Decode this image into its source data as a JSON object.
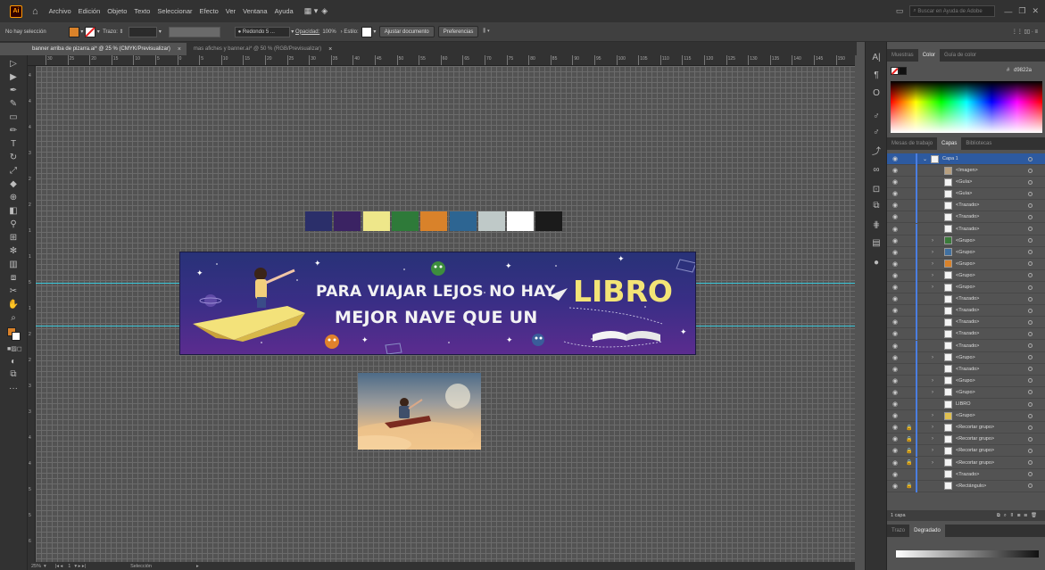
{
  "menubar": {
    "app_logo": "Ai",
    "items": [
      "Archivo",
      "Edición",
      "Objeto",
      "Texto",
      "Seleccionar",
      "Efecto",
      "Ver",
      "Ventana",
      "Ayuda"
    ],
    "search_placeholder": "Buscar en Ayuda de Adobe"
  },
  "controlbar": {
    "selection_status": "No hay selección",
    "fill_color": "#d9822a",
    "stroke_label": "Trazo:",
    "brush_label": "Redondo 5 ...",
    "opacity_label": "Opacidad:",
    "opacity_value": "100%",
    "style_label": "Estilo:",
    "fit_document_button": "Ajustar documento",
    "preferences_button": "Preferencias"
  },
  "tabs": [
    {
      "label": "banner arriba de pizarra.ai* @ 25 % (CMYK/Previsualizar)",
      "close": "×"
    },
    {
      "label": "mas afiches y banner.ai* @ 50 % (RGB/Previsualizar)",
      "close": "×"
    }
  ],
  "rulers": {
    "top": [
      "30",
      "25",
      "20",
      "15",
      "10",
      "5",
      "0",
      "5",
      "10",
      "15",
      "20",
      "25",
      "30",
      "35",
      "40",
      "45",
      "50",
      "55",
      "60",
      "65",
      "70",
      "75",
      "80",
      "85",
      "90",
      "95",
      "100",
      "105",
      "110",
      "115",
      "120",
      "125",
      "130",
      "135",
      "140",
      "145",
      "150",
      "155"
    ],
    "left": [
      "4",
      "4",
      "4",
      "3",
      "2",
      "2",
      "1",
      "1",
      "5",
      "1",
      "2",
      "2",
      "3",
      "3",
      "4",
      "4",
      "5",
      "5",
      "6"
    ]
  },
  "palette": [
    "#2b2f6a",
    "#3b2363",
    "#eee78a",
    "#2e7a39",
    "#d9822a",
    "#2d6592",
    "#bfc9c8",
    "#ffffff",
    "#1b1b1b"
  ],
  "banner": {
    "line1": "PARA VIAJAR LEJOS NO HAY",
    "line2": "MEJOR NAVE QUE UN",
    "highlight": "LIBRO"
  },
  "statusbar": {
    "zoom": "25%",
    "artboard": "1",
    "tool": "Selección"
  },
  "color_panel": {
    "tabs": [
      "Muestras",
      "Color",
      "Guía de color"
    ],
    "active_tab": "Color",
    "hex_label": "#",
    "hex_value": "d9822a"
  },
  "layers_panel": {
    "tabs": [
      "Mesas de trabajo",
      "Capas",
      "Bibliotecas"
    ],
    "active_tab": "Capas",
    "layer_name": "Capa 1",
    "items": [
      {
        "name": "<Imagen>",
        "expand": "",
        "lock": "",
        "thumb": "#b8a080"
      },
      {
        "name": "<Guía>",
        "expand": "",
        "lock": "",
        "thumb": "#f4f4f4"
      },
      {
        "name": "<Guía>",
        "expand": "",
        "lock": "",
        "thumb": "#f4f4f4"
      },
      {
        "name": "<Trazado>",
        "expand": "",
        "lock": "",
        "thumb": "#f4f4f4"
      },
      {
        "name": "<Trazado>",
        "expand": "",
        "lock": "",
        "thumb": "#f4f4f4"
      },
      {
        "name": "<Trazado>",
        "expand": "",
        "lock": "",
        "thumb": "#f4f4f4"
      },
      {
        "name": "<Grupo>",
        "expand": "›",
        "lock": "",
        "thumb": "#3a7a3a"
      },
      {
        "name": "<Grupo>",
        "expand": "›",
        "lock": "",
        "thumb": "#4070a0"
      },
      {
        "name": "<Grupo>",
        "expand": "›",
        "lock": "",
        "thumb": "#d9822a"
      },
      {
        "name": "<Grupo>",
        "expand": "›",
        "lock": "",
        "thumb": "#f4f4f4"
      },
      {
        "name": "<Grupo>",
        "expand": "›",
        "lock": "",
        "thumb": "#f4f4f4"
      },
      {
        "name": "<Trazado>",
        "expand": "",
        "lock": "",
        "thumb": "#f4f4f4"
      },
      {
        "name": "<Trazado>",
        "expand": "",
        "lock": "",
        "thumb": "#f4f4f4"
      },
      {
        "name": "<Trazado>",
        "expand": "",
        "lock": "",
        "thumb": "#f4f4f4"
      },
      {
        "name": "<Trazado>",
        "expand": "",
        "lock": "",
        "thumb": "#f4f4f4"
      },
      {
        "name": "<Trazado>",
        "expand": "",
        "lock": "",
        "thumb": "#f4f4f4"
      },
      {
        "name": "<Grupo>",
        "expand": "›",
        "lock": "",
        "thumb": "#f4f4f4"
      },
      {
        "name": "<Trazado>",
        "expand": "",
        "lock": "",
        "thumb": "#f4f4f4"
      },
      {
        "name": "<Grupo>",
        "expand": "›",
        "lock": "",
        "thumb": "#f4f4f4"
      },
      {
        "name": "<Grupo>",
        "expand": "›",
        "lock": "",
        "thumb": "#f4f4f4"
      },
      {
        "name": "LIBRO",
        "expand": "",
        "lock": "",
        "thumb": "#f4f4f4"
      },
      {
        "name": "<Grupo>",
        "expand": "›",
        "lock": "",
        "thumb": "#e0c050"
      },
      {
        "name": "<Recortar grupo>",
        "expand": "›",
        "lock": "🔒",
        "thumb": "#f4f4f4"
      },
      {
        "name": "<Recortar grupo>",
        "expand": "›",
        "lock": "🔒",
        "thumb": "#f4f4f4"
      },
      {
        "name": "<Recortar grupo>",
        "expand": "›",
        "lock": "🔒",
        "thumb": "#f4f4f4"
      },
      {
        "name": "<Recortar grupo>",
        "expand": "›",
        "lock": "🔒",
        "thumb": "#f4f4f4"
      },
      {
        "name": "<Trazado>",
        "expand": "",
        "lock": "",
        "thumb": "#f4f4f4"
      },
      {
        "name": "<Rectángulo>",
        "expand": "",
        "lock": "🔒",
        "thumb": "#f4f4f4"
      }
    ],
    "footer_count": "1 capa"
  },
  "bottom_panel": {
    "tabs": [
      "Trazo",
      "Degradado"
    ],
    "active_tab": "Degradado"
  }
}
